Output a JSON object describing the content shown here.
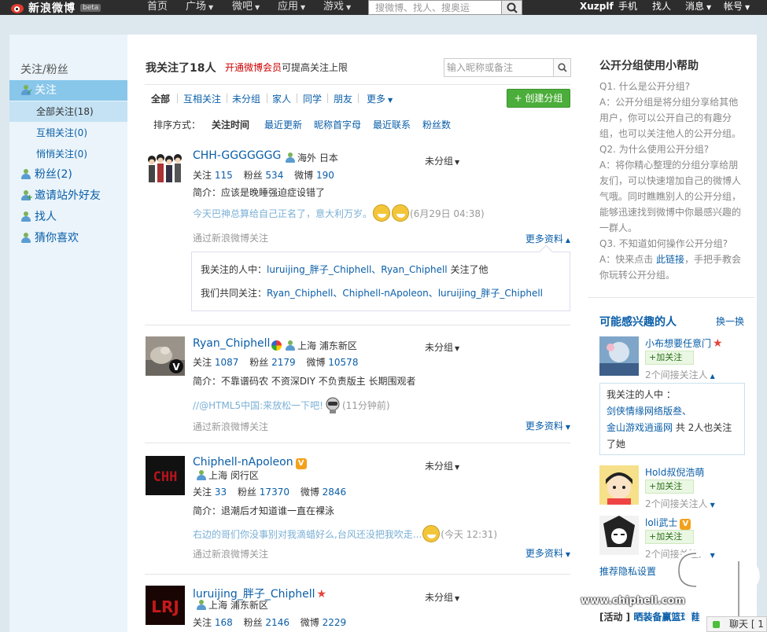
{
  "topbar": {
    "logo": "新浪微博",
    "beta": "beta",
    "nav": [
      "首页",
      "广场",
      "微吧",
      "应用",
      "游戏"
    ],
    "search_placeholder": "搜微博、找人、搜奥运",
    "user": "Xuzplf",
    "links": [
      "手机",
      "找人",
      "消息",
      "帐号"
    ]
  },
  "sidebar": {
    "heading": "关注/粉丝",
    "follow": "关注",
    "sub": [
      "全部关注(18)",
      "互相关注(0)",
      "悄悄关注(0)"
    ],
    "items": [
      "粉丝(2)",
      "邀请站外好友",
      "找人",
      "猜你喜欢"
    ]
  },
  "main": {
    "title": "我关注了18人",
    "vip_link": "开通微博会员",
    "vip_text": "可提高关注上限",
    "search_placeholder": "输入昵称或备注",
    "tabs": [
      "全部",
      "互相关注",
      "未分组",
      "家人",
      "同学",
      "朋友",
      "更多"
    ],
    "create_group": "+ 创建分组",
    "sort_label": "排序方式：",
    "sorts": [
      "关注时间",
      "最近更新",
      "昵称首字母",
      "最近联系",
      "粉丝数"
    ]
  },
  "labels": {
    "follow": "关注",
    "fans": "粉丝",
    "weibo": "微博",
    "group": "未分组",
    "via": "通过新浪微博关注",
    "more": "更多资料"
  },
  "users": [
    {
      "name": "CHH-GGGGGGG",
      "location": "海外 日本",
      "follow": "115",
      "fans": "534",
      "weibo": "190",
      "bio": "简介：应该是晚睡强迫症设错了",
      "post": "今天巴神总算给自己正名了，意大利万岁。",
      "time": "(6月29日 04:38)",
      "detail_1_prefix": "我关注的人中：",
      "detail_1_names": "luruijing_胖子_Chiphell、Ryan_Chiphell",
      "detail_1_suffix": " 关注了他",
      "detail_2_prefix": "我们共同关注：",
      "detail_2_names": "Ryan_Chiphell、Chiphell-nApoleon、luruijing_胖子_Chiphell"
    },
    {
      "name": "Ryan_Chiphell",
      "location": "上海 浦东新区",
      "follow": "1087",
      "fans": "2179",
      "weibo": "10578",
      "bio": "简介：不靠谱码农 不资深DIY 不负责版主 长期围观者",
      "post": "//@HTML5中国:来放松一下吧!",
      "time": "(11分钟前)"
    },
    {
      "name": "Chiphell-nApoleon",
      "location": "上海 闵行区",
      "follow": "33",
      "fans": "17370",
      "weibo": "2846",
      "bio": "简介：退潮后才知道谁一直在裸泳",
      "post": "右边的哥们你没事别对我滴蜡好么,台风还没把我吹走...",
      "time": "(今天 12:31)"
    },
    {
      "name": "luruijing_胖子_Chiphell",
      "location": "上海 浦东新区",
      "follow": "168",
      "fans": "2146",
      "weibo": "2229"
    }
  ],
  "help": {
    "title": "公开分组使用小帮助",
    "q1": "Q1. 什么是公开分组?",
    "a1": "A：公开分组是将分组分享给其他用户，你可以公开自己的有趣分组，也可以关注他人的公开分组。",
    "q2": "Q2. 为什么使用公开分组?",
    "a2": "A：将你精心整理的分组分享给朋友们，可以快速增加自己的微博人气哦。同时瞧瞧别人的公开分组，能够迅速找到微博中你最感兴趣的一群人。",
    "q3": "Q3. 不知道如何操作公开分组?",
    "a3_prefix": "A：快来点击 ",
    "a3_link": "此链接",
    "a3_suffix": "，手把手教会你玩转公开分组。"
  },
  "interest": {
    "title": "可能感兴趣的人",
    "change": "换一换",
    "add_label": "+加关注",
    "people": [
      {
        "name": "小布想要任意门",
        "indirect": "2个间接关注人"
      },
      {
        "name": "Hold叔倪浩萌",
        "indirect": "2个间接关注人"
      },
      {
        "name": "loli武士",
        "indirect": "2个间接关注人"
      }
    ],
    "box_prefix": "我关注的人中 ：",
    "box_name1": "剑侠情缘网络版叁、",
    "box_name2": "金山游戏逍遥网",
    "box_suffix": " 共 2人也关注了她",
    "privacy": "推荐隐私设置",
    "activity_tag": "[活动 ]",
    "activity": "晒装备赢篮球鞋",
    "chat": "聊天 [ 1 ]"
  },
  "watermark": "www.chiphell.com",
  "colors": {
    "accent": "#0a5ea8",
    "sidebar_active": "#88c6ea",
    "green": "#4cae3a",
    "vip": "#cc0000"
  }
}
